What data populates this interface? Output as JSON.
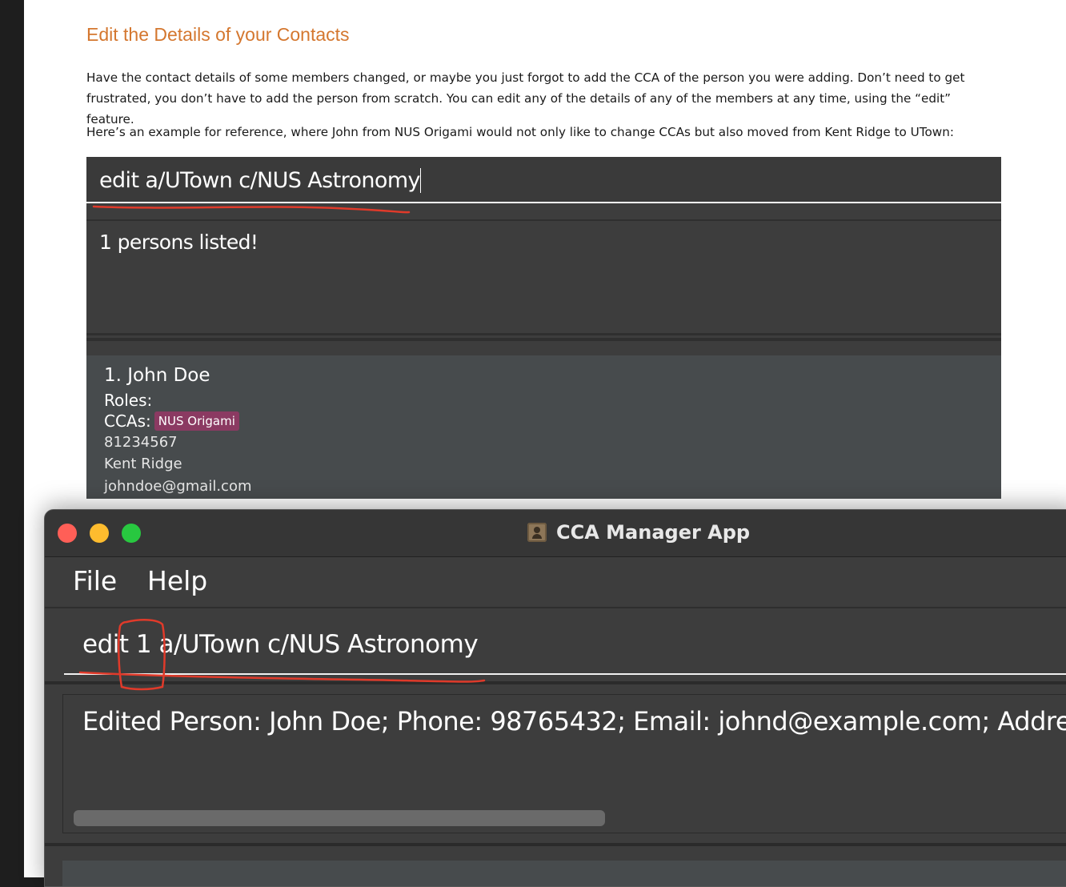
{
  "doc": {
    "heading": "Edit the Details of your Contacts",
    "para1": "Have the contact details of some members changed, or maybe you just forgot to add the CCA of the person you were adding. Don’t need to get frustrated, you don’t have to add the person from scratch. You can edit any of the details of any of the members at any time, using the “edit” feature.",
    "para2": "Here’s an example for reference, where John from NUS Origami would not only like to change CCAs but also moved from Kent Ridge to UTown:",
    "screenshot": {
      "command": "edit a/UTown c/NUS Astronomy",
      "result": "1 persons listed!",
      "person": {
        "name": "1.  John Doe",
        "roles": "Roles:",
        "ccas_label": "CCAs:",
        "cca_tag": "NUS Origami",
        "phone": "81234567",
        "address": "Kent Ridge",
        "email": "johndoe@gmail.com"
      }
    }
  },
  "window": {
    "title": "CCA Manager App",
    "menu": {
      "file": "File",
      "help": "Help"
    },
    "command": "edit 1 a/UTown c/NUS Astronomy",
    "result": "Edited Person: John Doe; Phone: 98765432; Email: johnd@example.com; Address: U"
  },
  "colors": {
    "heading": "#d4772f",
    "tag": "#8b3a62",
    "annotation": "#e03a2a",
    "close": "#ff5f57",
    "minimize": "#febc2e",
    "maximize": "#28c840"
  }
}
